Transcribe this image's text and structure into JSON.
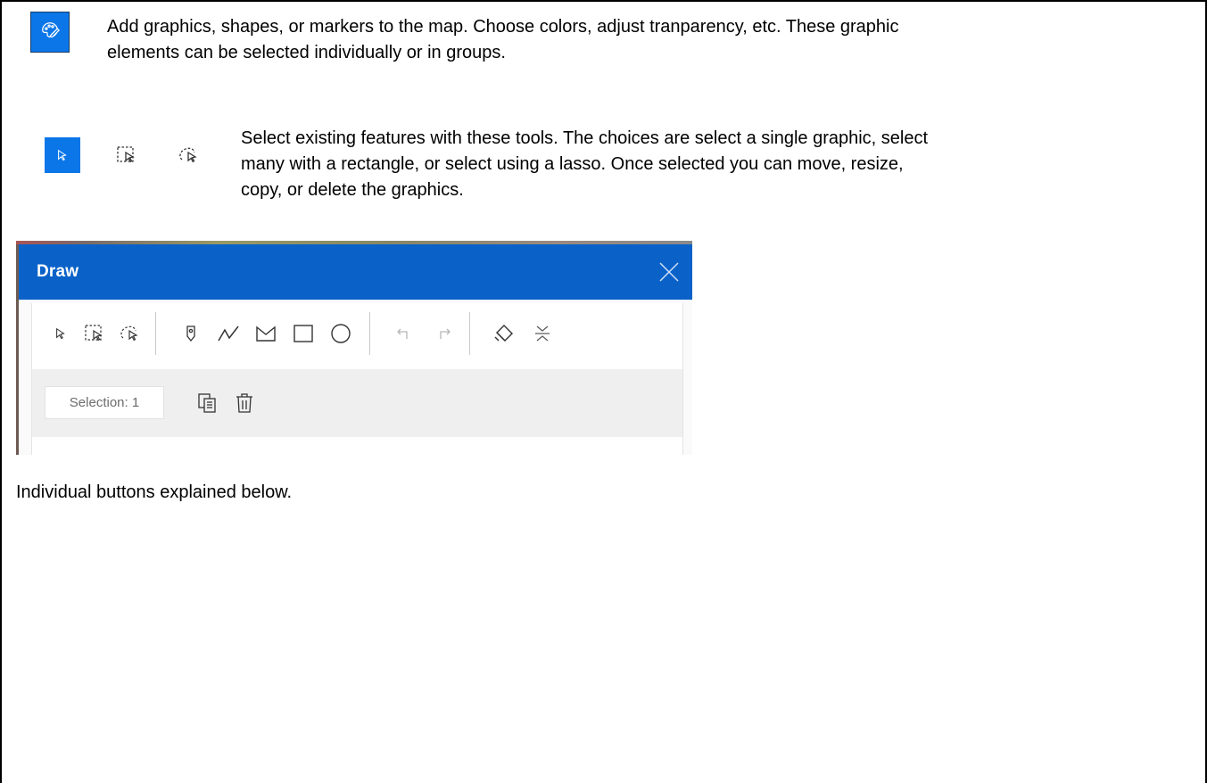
{
  "intro": {
    "line1": "Add graphics, shapes, or markers to the map. Choose colors, adjust tranparency, etc.  These graphic",
    "line2": "elements can be selected individually or in groups.",
    "icon": "palette-eraser-icon"
  },
  "selection_tools": {
    "line1": "Select existing features with these tools.  The choices are select a single graphic, select",
    "line2": "many with a rectangle, or select using a lasso.  Once selected you can move, resize,",
    "line3": "copy, or delete the graphics.",
    "icons": [
      "select-arrow-icon",
      "rectangle-select-icon",
      "lasso-select-icon"
    ]
  },
  "draw_widget": {
    "title": "Draw",
    "selection_label": "Selection: 1",
    "toolbar_icons": [
      "select-arrow-icon",
      "rectangle-select-icon",
      "lasso-select-icon",
      "point-marker-icon",
      "polyline-icon",
      "polygon-icon",
      "rectangle-icon",
      "circle-icon",
      "undo-icon",
      "redo-icon",
      "eraser-icon",
      "collapse-icon"
    ],
    "selection_icons": [
      "duplicate-icon",
      "trash-icon"
    ],
    "colors": {
      "header": "#0a62c9",
      "accent": "#0b76e8"
    }
  },
  "footer": {
    "text": "Individual buttons explained below."
  }
}
